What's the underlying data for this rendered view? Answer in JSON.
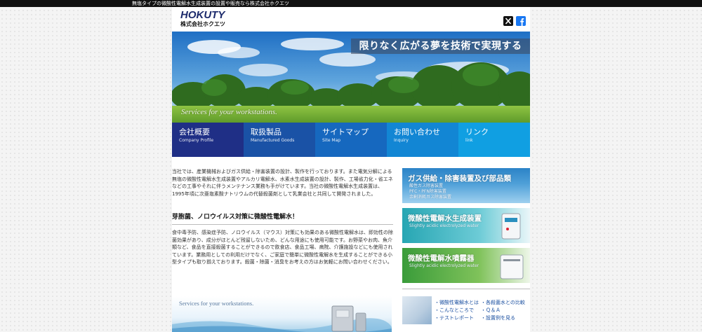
{
  "top_bar": {
    "text": "無塩タイプの微酸性電解水生成装置の設置や販売なら株式会社ホクエツ"
  },
  "header": {
    "logo_en": "HOKUTY",
    "logo_jp": "株式会社ホクエツ",
    "social_icons": [
      "x-icon",
      "facebook-icon"
    ]
  },
  "hero": {
    "catchphrase": "限りなく広がる夢を技術で実現する",
    "subtitle": "Services for your workstations."
  },
  "nav": {
    "items": [
      {
        "label": "会社概要",
        "sub": "Company Profile",
        "color": "#1f2f86"
      },
      {
        "label": "取扱製品",
        "sub": "Manufactured Goods",
        "color": "#1a52a6"
      },
      {
        "label": "サイトマップ",
        "sub": "Site Map",
        "color": "#1668bf"
      },
      {
        "label": "お問い合わせ",
        "sub": "Inquiry",
        "color": "#1286d4"
      },
      {
        "label": "リンク",
        "sub": "link",
        "color": "#109fe2"
      }
    ]
  },
  "main": {
    "intro": "当社では、産業機械およびガス供給・除害装置の設計、製作を行っております。また電気分解による無塩の微酸性電解水生成装置やアルカリ電解水、水素水生成装置の設計、製作、工場省力化・省エネなどの工事やそれに伴うメンテナンス業務も手がけています。当社の微酸性電解水生成装置は、1995年頃に次亜塩素酸ナトリウムの代替殺菌剤として乳業会社と共同して開発されました。",
    "section_title": "芽胞菌、ノロウイルス対策に微酸性電解水！",
    "section_body": "食中毒予防、感染症予防、ノロウイルス（マウス）対策にも効果のある微酸性電解水は、即効性の除菌効果があり、成分がほとんど残留しないため、どんな用途にも使用可能です。お野菜やお肉、魚介類など、食品を直接殺菌することができるので飲食店、食品工場、病院、介護施設などにも使用されています。業務用としての利用だけでなく、ご家庭で簡単に微酸性電解水を生成することができる小型タイプも取り揃えております。殺菌・除菌・消臭をお考えの方はお気軽にお問い合わせください。",
    "banner_caption": "Services for your workstations."
  },
  "sidebar": {
    "banners": [
      {
        "title": "ガス供給・除害装置及び部品類",
        "subs": [
          "酸性ガス除害装置",
          "PFC・PFN除害装置",
          "余剰消耗ガス除害装置"
        ]
      },
      {
        "title": "微酸性電解水生成装置",
        "subs": [
          "Slightly acidic electrolyzed water"
        ]
      },
      {
        "title": "微酸性電解水噴霧器",
        "subs": [
          "Slightly acidic electrolyzed water"
        ]
      }
    ],
    "links_col1": [
      "・微酸性電解水とは",
      "・こんなところで",
      "・テストレポート"
    ],
    "links_col2": [
      "・各殺菌水との比較",
      "・Ｑ＆Ａ",
      "・設置例を見る"
    ]
  }
}
